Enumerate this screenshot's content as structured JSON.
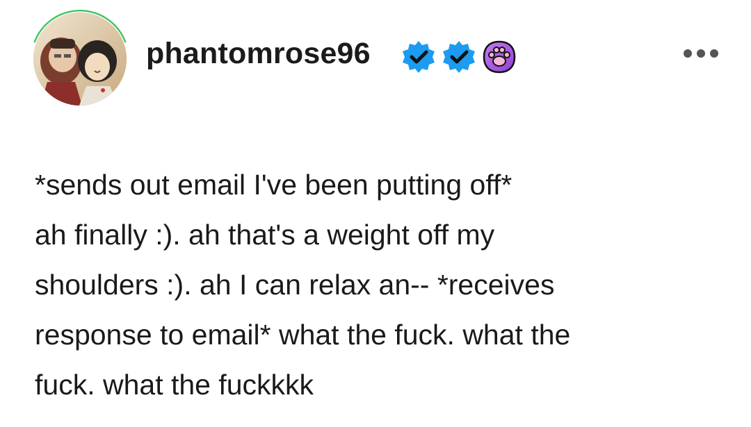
{
  "post": {
    "username": "phantomrose96",
    "badges": [
      {
        "icon": "verified-check-icon",
        "color": "#1d9bf0"
      },
      {
        "icon": "verified-check-icon",
        "color": "#1d9bf0"
      },
      {
        "icon": "paw-print-icon",
        "color": "#b25ce8"
      }
    ],
    "more_icon": "ellipsis-icon",
    "lines": [
      "*sends out email I've been putting off*",
      "ah finally :). ah that's a weight off my",
      "shoulders :). ah I can relax an-- *receives",
      "response to email* what the fuck. what the",
      "fuck. what the fuckkkk"
    ]
  },
  "colors": {
    "text": "#1a1a1a",
    "verified": "#1d9bf0",
    "paw_badge": "#b25ce8",
    "avatar_ring": "#3fc15a"
  }
}
